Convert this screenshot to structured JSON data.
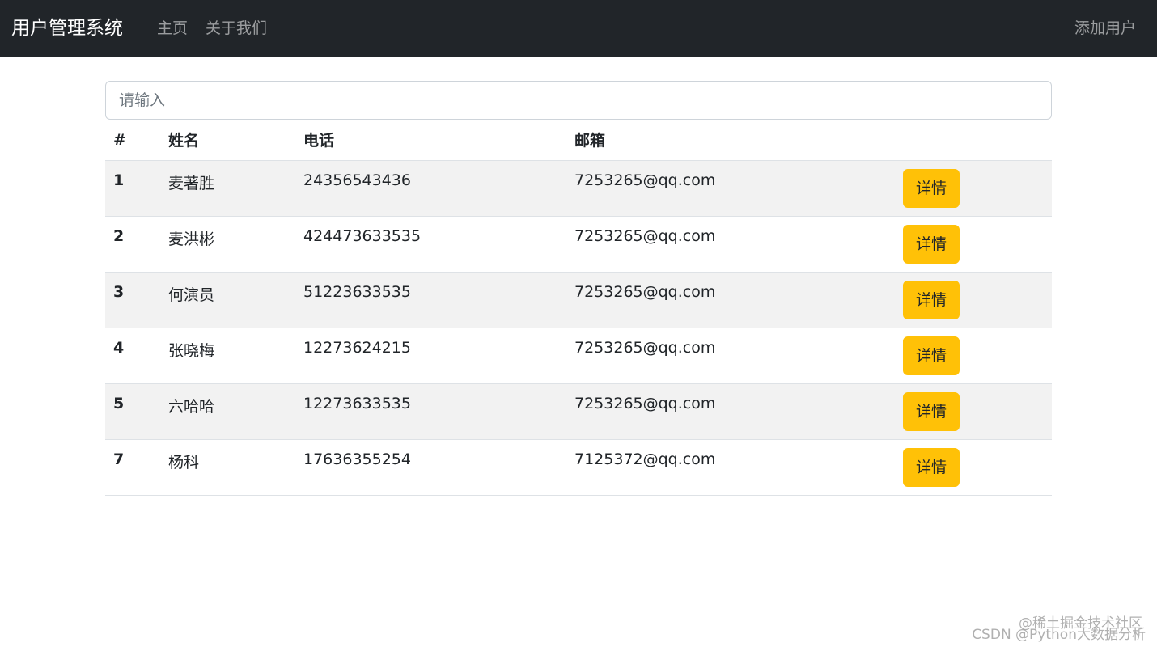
{
  "navbar": {
    "brand": "用户管理系统",
    "links": [
      "主页",
      "关于我们"
    ],
    "add_user": "添加用户"
  },
  "search": {
    "placeholder": "请输入",
    "value": ""
  },
  "table": {
    "headers": [
      "#",
      "姓名",
      "电话",
      "邮箱",
      ""
    ],
    "rows": [
      {
        "id": "1",
        "name": "麦著胜",
        "phone": "24356543436",
        "email": "7253265@qq.com",
        "action": "详情"
      },
      {
        "id": "2",
        "name": "麦洪彬",
        "phone": "424473633535",
        "email": "7253265@qq.com",
        "action": "详情"
      },
      {
        "id": "3",
        "name": "何演员",
        "phone": "51223633535",
        "email": "7253265@qq.com",
        "action": "详情"
      },
      {
        "id": "4",
        "name": "张晓梅",
        "phone": "12273624215",
        "email": "7253265@qq.com",
        "action": "详情"
      },
      {
        "id": "5",
        "name": "六哈哈",
        "phone": "12273633535",
        "email": "7253265@qq.com",
        "action": "详情"
      },
      {
        "id": "7",
        "name": "杨科",
        "phone": "17636355254",
        "email": "7125372@qq.com",
        "action": "详情"
      }
    ]
  },
  "watermark": {
    "line1": "@稀土掘金技术社区",
    "line2": "CSDN @Python大数据分析"
  }
}
